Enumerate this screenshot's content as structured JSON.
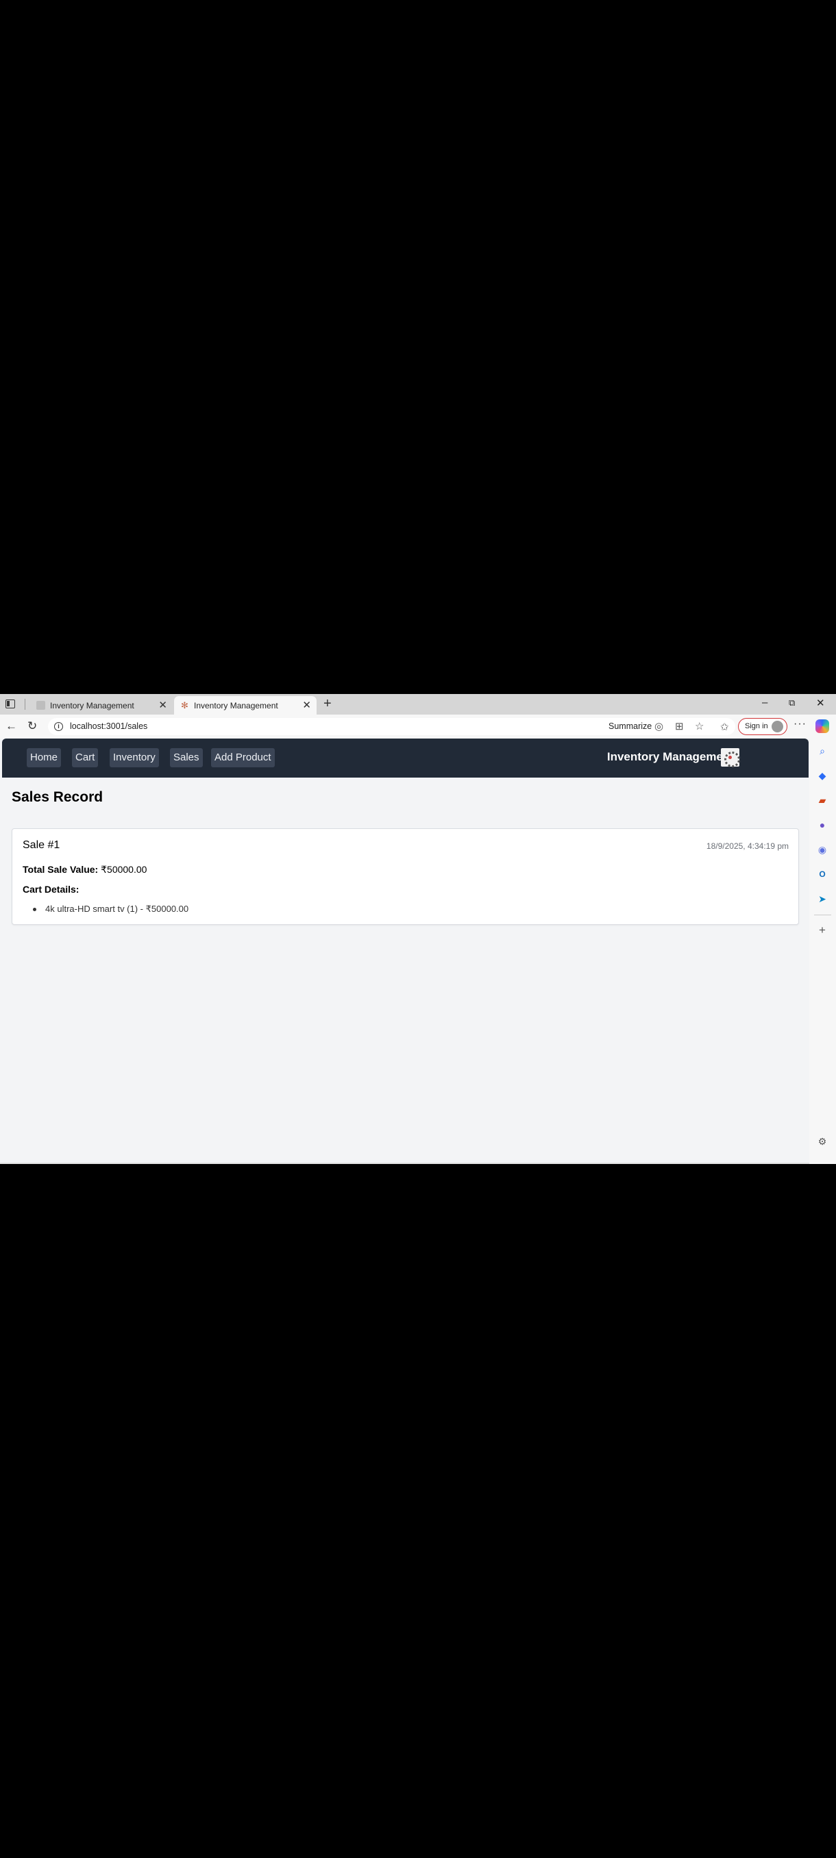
{
  "browser": {
    "tabs": [
      {
        "title": "Inventory Management",
        "active": false
      },
      {
        "title": "Inventory Management",
        "active": true
      }
    ],
    "new_tab_glyph": "+",
    "url": "localhost:3001/sales",
    "summarize_label": "Summarize",
    "sign_in_label": "Sign in",
    "window_controls": {
      "minimize": "–",
      "restore": "⧉",
      "close": "✕"
    }
  },
  "app": {
    "nav": [
      "Home",
      "Cart",
      "Inventory",
      "Sales",
      "Add Product"
    ],
    "brand": "Inventory Management",
    "page_title": "Sales Record",
    "sales": [
      {
        "title": "Sale #1",
        "date": "18/9/2025, 4:34:19 pm",
        "total_label": "Total Sale Value:",
        "total_value": "₹50000.00",
        "cart_heading": "Cart Details:",
        "items": [
          "4k ultra-HD smart tv (1) - ₹50000.00"
        ]
      }
    ]
  },
  "colors": {
    "navbar": "#212a37",
    "nav_button": "#3b4556",
    "page_bg": "#f3f4f6",
    "sign_in_border": "#d13438"
  },
  "sidebar_icons": [
    "search-icon",
    "tag-icon",
    "toolbox-icon",
    "people-icon",
    "copilot-circle-icon",
    "outlook-icon",
    "send-icon",
    "add-icon",
    "settings-icon"
  ]
}
